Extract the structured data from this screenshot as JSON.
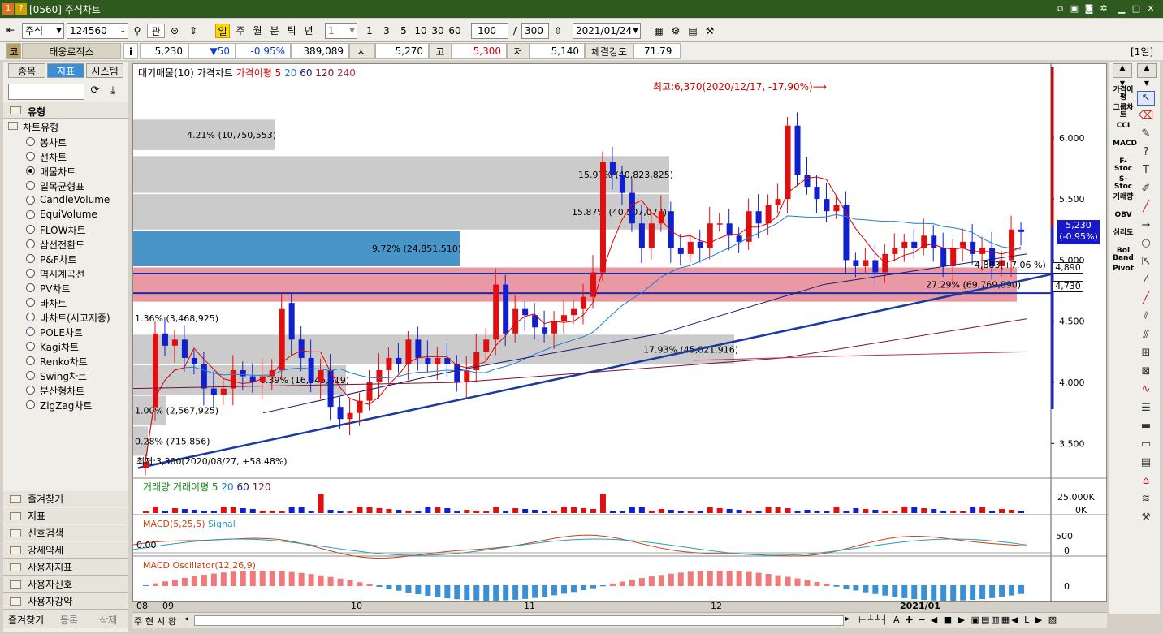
{
  "window": {
    "title": "[0560] 주식차트",
    "badge1": "1",
    "badge2": "?"
  },
  "toolbar": {
    "market": "주식",
    "code": "124560",
    "btn_search": "관",
    "period_buttons": [
      "일",
      "주",
      "월",
      "분",
      "틱",
      "년"
    ],
    "unit_value": "1",
    "quick_nums": [
      "1",
      "3",
      "5",
      "10",
      "30",
      "60"
    ],
    "count": "100",
    "slash": "/",
    "total": "300",
    "date": "2021/01/24"
  },
  "quote": {
    "code_label": "코",
    "name": "태웅로직스",
    "info_btn": "i",
    "price": "5,230",
    "change": "▼50",
    "change_pct": "-0.95%",
    "volume": "389,089",
    "open_label": "시",
    "open": "5,270",
    "high_label": "고",
    "high": "5,300",
    "low_label": "저",
    "low": "5,140",
    "strength_label": "체결강도",
    "strength": "71.79",
    "period_tag": "[1일]"
  },
  "left_panel": {
    "tabs": [
      "종목",
      "지표",
      "시스템"
    ],
    "type_header": "유형",
    "tree_root": "차트유형",
    "chart_types": [
      "봉차트",
      "선차트",
      "매물차트",
      "일목균형표",
      "CandleVolume",
      "EquiVolume",
      "FLOW차트",
      "삼선전환도",
      "P&F차트",
      "역시계곡선",
      "PV차트",
      "바차트",
      "바차트(시고저종)",
      "POLE차트",
      "Kagi차트",
      "Renko차트",
      "Swing차트",
      "분산형차트",
      "ZigZag차트"
    ],
    "selected_index": 2,
    "folders": [
      "즐겨찾기",
      "지표",
      "신호검색",
      "강세약세",
      "사용자지표",
      "사용자신호",
      "사용자강약"
    ],
    "bottom_tabs": [
      "즐겨찾기",
      "등록",
      "삭제"
    ]
  },
  "right_tools": [
    "가격이평",
    "그룹차트",
    "CCI",
    "MACD",
    "F-Stoc",
    "S-Stoc",
    "거래량",
    "OBV",
    "심리도",
    "Bol Band",
    "Pivot"
  ],
  "chart": {
    "legend_price": [
      "대기매물(10)",
      "가격차트",
      "가격이평 5",
      "20",
      "60",
      "120",
      "240"
    ],
    "legend_colors": {
      "ma5": "#e00000",
      "ma20": "#1e7fd0",
      "ma60": "#1a1a6e",
      "ma120": "#7a1030",
      "ma240": "#c03050"
    },
    "annot_high": "최고:6,370(2020/12/17, -17.90%)⟶",
    "annot_low": "최저:3,300(2020/08/27, +58.48%)",
    "price_label": "5,230",
    "price_label_pct": "(-0.95%)",
    "hline1": "4,890",
    "hline2": "4,730",
    "trend_label": "4,883(+7.06 %)",
    "legend_volume": [
      "거래량",
      "거래이평 5",
      "20",
      "60",
      "120"
    ],
    "legend_macd": [
      "MACD(5,25,5)",
      "Signal"
    ],
    "legend_osc": [
      "MACD Oscillator(12,26,9)"
    ],
    "vol_axis": [
      "25,000K",
      "0K"
    ],
    "macd_axis": [
      "500",
      "0"
    ],
    "macd_zero": "0.00",
    "osc_axis": [
      "0"
    ],
    "x_labels": [
      "08",
      "09",
      "10",
      "11",
      "12",
      "2021/01"
    ],
    "status_tabs": [
      "주",
      "현",
      "시",
      "황"
    ]
  },
  "chart_data": {
    "type": "candlestick",
    "y_ticks": [
      3500,
      4000,
      4500,
      5000,
      5500,
      6000
    ],
    "ylim": [
      3250,
      6550
    ],
    "volume_profile": [
      {
        "label": "4.21% (10,750,553)",
        "low": 5900,
        "high": 6150,
        "color": "#c8c8c8"
      },
      {
        "label": "15.97% (40,823,825)",
        "low": 5550,
        "high": 5850,
        "color": "#c8c8c8"
      },
      {
        "label": "15.87% (40,507,077)",
        "low": 5250,
        "high": 5540,
        "color": "#c8c8c8"
      },
      {
        "label": "9.72% (24,851,510)",
        "low": 4950,
        "high": 5240,
        "color": "#3f8fc4"
      },
      {
        "label": "27.29% (69,769,890)",
        "low": 4660,
        "high": 4940,
        "color": "#e8939f"
      },
      {
        "label": "1.36% (3,468,925)",
        "low": 4400,
        "high": 4650,
        "color": "#ffffff"
      },
      {
        "label": "17.93% (45,821,916)",
        "low": 4150,
        "high": 4390,
        "color": "#c8c8c8"
      },
      {
        "label": "6.39% (16,345,619)",
        "low": 3900,
        "high": 4140,
        "color": "#c8c8c8"
      },
      {
        "label": "1.00% (2,567,925)",
        "low": 3650,
        "high": 3890,
        "color": "#c8c8c8"
      },
      {
        "label": "0.28% (715,856)",
        "low": 3400,
        "high": 3640,
        "color": "#c8c8c8"
      }
    ],
    "close": [
      3350,
      4400,
      4300,
      4350,
      4200,
      4150,
      3950,
      3900,
      3950,
      4100,
      4050,
      4000,
      4050,
      4100,
      4600,
      4350,
      4200,
      4000,
      4100,
      3800,
      3700,
      3750,
      3850,
      4000,
      4100,
      4200,
      4150,
      4350,
      4200,
      4150,
      4200,
      4150,
      4000,
      4100,
      4250,
      4350,
      4800,
      4400,
      4600,
      4550,
      4450,
      4400,
      4500,
      4550,
      4600,
      4700,
      4900,
      5800,
      5700,
      5550,
      5300,
      5100,
      5300,
      5400,
      5100,
      5050,
      5150,
      5100,
      5300,
      5300,
      5200,
      5150,
      5400,
      5300,
      5450,
      5500,
      6100,
      5700,
      5600,
      5500,
      5400,
      5450,
      5000,
      4950,
      5000,
      4900,
      5050,
      5100,
      5150,
      5100,
      5200,
      5100,
      4950,
      5100,
      5150,
      5050,
      5100,
      4950,
      5000,
      5250,
      5230
    ],
    "open": [
      3300,
      3800,
      4400,
      4300,
      4350,
      4200,
      4150,
      3950,
      3900,
      3950,
      4100,
      4050,
      4000,
      4050,
      4100,
      4650,
      4350,
      4200,
      4000,
      4100,
      3800,
      3700,
      3750,
      3850,
      4000,
      4100,
      4200,
      4150,
      4350,
      4200,
      4150,
      4200,
      4150,
      4000,
      4100,
      4250,
      4350,
      4800,
      4400,
      4600,
      4550,
      4450,
      4400,
      4500,
      4550,
      4600,
      4700,
      4900,
      5800,
      5700,
      5550,
      5300,
      5100,
      5300,
      5400,
      5100,
      5050,
      5150,
      5100,
      5300,
      5300,
      5200,
      5150,
      5400,
      5300,
      5450,
      5500,
      6100,
      5700,
      5600,
      5500,
      5400,
      5450,
      5000,
      4950,
      5000,
      4900,
      5050,
      5100,
      5150,
      5100,
      5200,
      5100,
      4950,
      5100,
      5150,
      5050,
      5100,
      4950,
      5000,
      5250
    ]
  }
}
